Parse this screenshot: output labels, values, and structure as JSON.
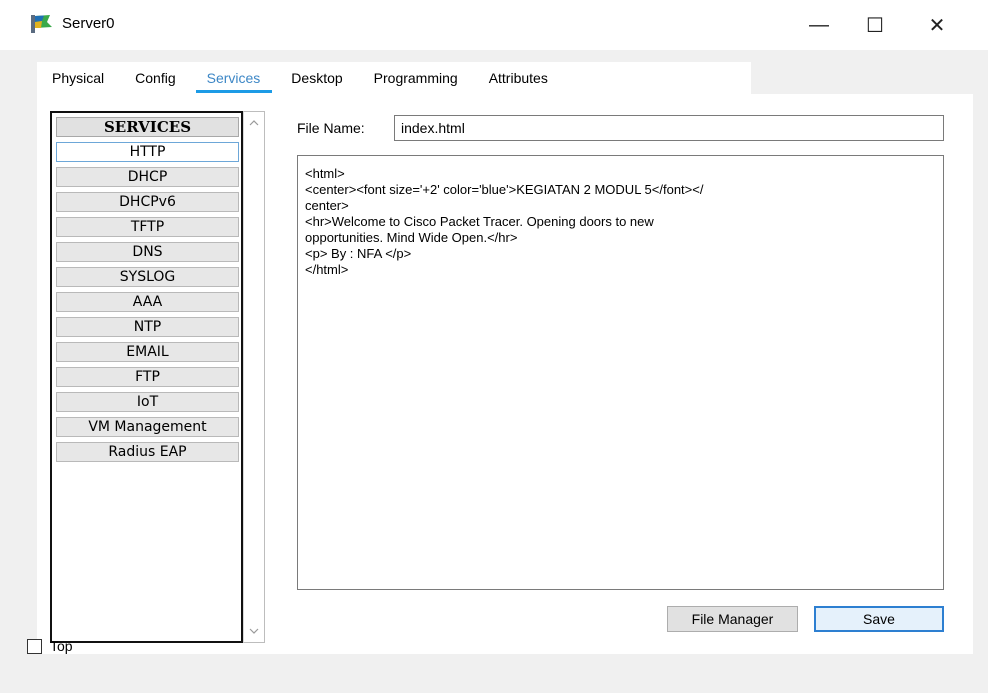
{
  "window": {
    "title": "Server0",
    "minimize_glyph": "—",
    "maximize_glyph": "☐",
    "close_glyph": "✕"
  },
  "tabs": [
    {
      "label": "Physical",
      "active": false
    },
    {
      "label": "Config",
      "active": false
    },
    {
      "label": "Services",
      "active": true
    },
    {
      "label": "Desktop",
      "active": false
    },
    {
      "label": "Programming",
      "active": false
    },
    {
      "label": "Attributes",
      "active": false
    }
  ],
  "services": {
    "header": "SERVICES",
    "selected": "HTTP",
    "items": [
      "HTTP",
      "DHCP",
      "DHCPv6",
      "TFTP",
      "DNS",
      "SYSLOG",
      "AAA",
      "NTP",
      "EMAIL",
      "FTP",
      "IoT",
      "VM Management",
      "Radius EAP"
    ]
  },
  "http": {
    "file_name_label": "File Name:",
    "file_name_value": "index.html",
    "content_lines": [
      "<html>",
      "<center><font size='+2' color='blue'>KEGIATAN 2 MODUL 5</font></",
      "center>",
      "<hr>Welcome to Cisco Packet Tracer. Opening doors to new",
      "opportunities. Mind Wide Open.</hr>",
      "<p> By : NFA </p>",
      "</html>"
    ],
    "file_manager_label": "File Manager",
    "save_label": "Save"
  },
  "footer": {
    "top_checkbox_label": "Top",
    "top_checked": false
  },
  "colors": {
    "active_tab_text": "#3d87c6",
    "active_tab_underline": "#1c9be6",
    "save_border": "#2d7fd1"
  },
  "icons": {
    "app": "server-icon",
    "scroll_up": "chevron-up-icon",
    "scroll_down": "chevron-down-icon"
  }
}
